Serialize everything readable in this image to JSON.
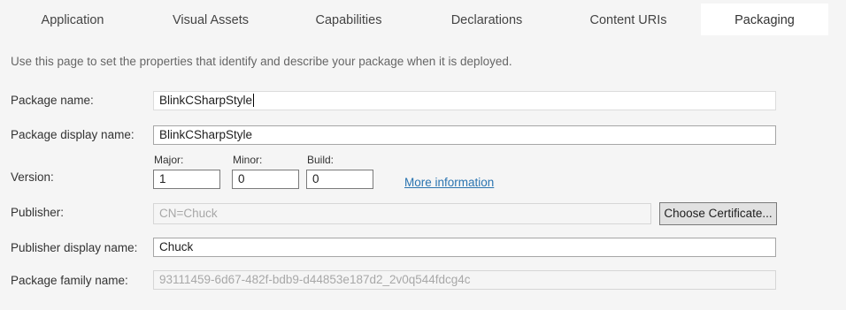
{
  "tabs": [
    {
      "label": "Application"
    },
    {
      "label": "Visual Assets"
    },
    {
      "label": "Capabilities"
    },
    {
      "label": "Declarations"
    },
    {
      "label": "Content URIs"
    },
    {
      "label": "Packaging",
      "active": true
    }
  ],
  "intro": "Use this page to set the properties that identify and describe your package when it is deployed.",
  "fields": {
    "package_name": {
      "label": "Package name:",
      "value": "BlinkCSharpStyle"
    },
    "package_display_name": {
      "label": "Package display name:",
      "value": "BlinkCSharpStyle"
    },
    "version": {
      "label": "Version:",
      "major": {
        "label": "Major:",
        "value": "1"
      },
      "minor": {
        "label": "Minor:",
        "value": "0"
      },
      "build": {
        "label": "Build:",
        "value": "0"
      },
      "more_info": "More information"
    },
    "publisher": {
      "label": "Publisher:",
      "value": "CN=Chuck",
      "button": "Choose Certificate..."
    },
    "publisher_display_name": {
      "label": "Publisher display name:",
      "value": "Chuck"
    },
    "package_family_name": {
      "label": "Package family name:",
      "value": "93111459-6d67-482f-bdb9-d44853e187d2_2v0q544fdcg4c"
    }
  }
}
